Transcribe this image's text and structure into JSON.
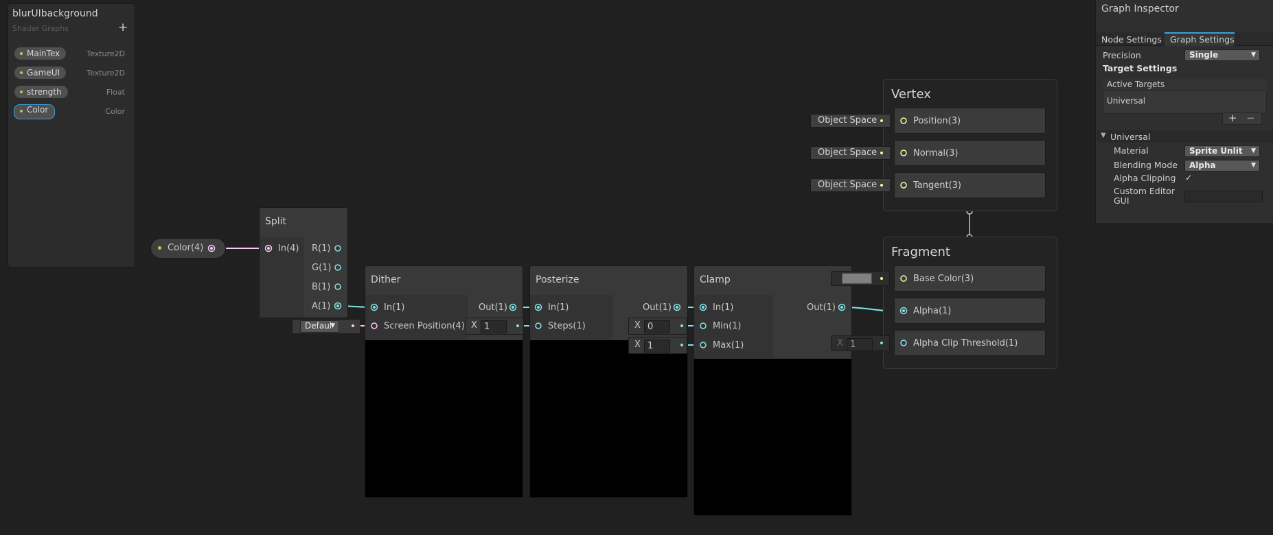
{
  "blackboard": {
    "title": "blurUIbackground",
    "subtitle": "Shader Graphs",
    "add": "+",
    "properties": [
      {
        "name": "MainTex",
        "type": "Texture2D"
      },
      {
        "name": "GameUI",
        "type": "Texture2D"
      },
      {
        "name": "strength",
        "type": "Float"
      },
      {
        "name": "Color",
        "type": "Color"
      }
    ]
  },
  "graph": {
    "color_prop": {
      "label": "Color(4)"
    },
    "split": {
      "title": "Split",
      "input": "In(4)",
      "outputs": [
        "R(1)",
        "G(1)",
        "B(1)",
        "A(1)"
      ]
    },
    "dither": {
      "title": "Dither",
      "inputs": [
        "In(1)",
        "Screen Position(4)"
      ],
      "output": "Out(1)",
      "screen_mode": "Defaul"
    },
    "posterize": {
      "title": "Posterize",
      "inputs": [
        "In(1)",
        "Steps(1)"
      ],
      "output": "Out(1)",
      "x_label": "X",
      "steps_value": "1"
    },
    "clamp": {
      "title": "Clamp",
      "inputs": [
        "In(1)",
        "Min(1)",
        "Max(1)"
      ],
      "output": "Out(1)",
      "x_label": "X",
      "min_value": "0",
      "max_value": "1"
    },
    "vertex": {
      "title": "Vertex",
      "blocks": [
        "Position(3)",
        "Normal(3)",
        "Tangent(3)"
      ],
      "space_label": "Object Space"
    },
    "fragment": {
      "title": "Fragment",
      "blocks": [
        "Base Color(3)",
        "Alpha(1)",
        "Alpha Clip Threshold(1)"
      ],
      "threshold_x": "X",
      "threshold_value": "1"
    }
  },
  "inspector": {
    "title": "Graph Inspector",
    "tabs": [
      "Node Settings",
      "Graph Settings"
    ],
    "active_tab": "Graph Settings",
    "precision_label": "Precision",
    "precision_value": "Single",
    "target_settings": "Target Settings",
    "active_targets": "Active Targets",
    "target_item": "Universal",
    "add": "+",
    "remove": "−",
    "universal_section": "Universal",
    "material_label": "Material",
    "material_value": "Sprite Unlit",
    "blending_label": "Blending Mode",
    "blending_value": "Alpha",
    "alpha_clip_label": "Alpha Clipping",
    "alpha_clip_check": "✓",
    "custom_editor_label_1": "Custom Editor",
    "custom_editor_label_2": "GUI"
  },
  "colors": {
    "background": "#202020",
    "float_wire": "#84e4e7",
    "vector3_wire": "#f6ff9a",
    "vector4_wire": "#fbcbf4",
    "selection": "#3b9fd8",
    "property_dot": "#a3d856"
  }
}
